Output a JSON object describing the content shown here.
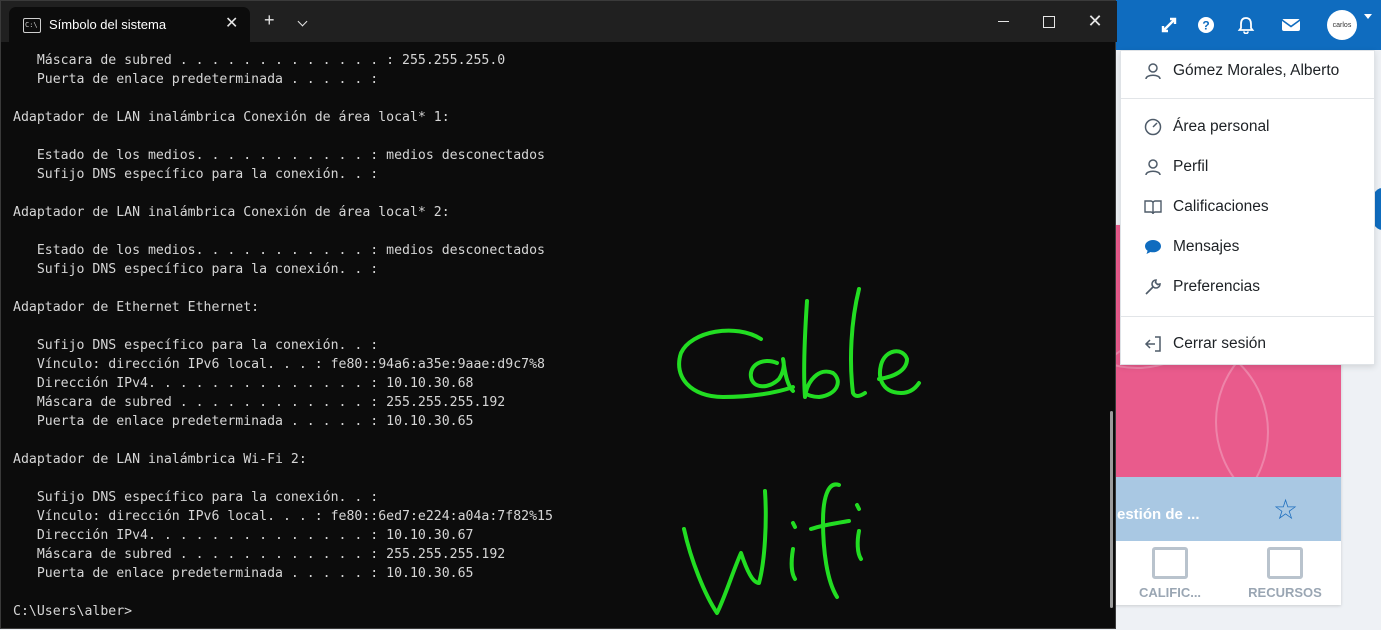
{
  "terminal": {
    "tab_title": "Símbolo del sistema",
    "lines": [
      "   Máscara de subred . . . . . . . . . . . . . : 255.255.255.0",
      "   Puerta de enlace predeterminada . . . . . : ",
      "",
      "Adaptador de LAN inalámbrica Conexión de área local* 1:",
      "",
      "   Estado de los medios. . . . . . . . . . . : medios desconectados",
      "   Sufijo DNS específico para la conexión. . : ",
      "",
      "Adaptador de LAN inalámbrica Conexión de área local* 2:",
      "",
      "   Estado de los medios. . . . . . . . . . . : medios desconectados",
      "   Sufijo DNS específico para la conexión. . : ",
      "",
      "Adaptador de Ethernet Ethernet:",
      "",
      "   Sufijo DNS específico para la conexión. . : ",
      "   Vínculo: dirección IPv6 local. . . : fe80::94a6:a35e:9aae:d9c7%8",
      "   Dirección IPv4. . . . . . . . . . . . . . : 10.10.30.68",
      "   Máscara de subred . . . . . . . . . . . . : 255.255.255.192",
      "   Puerta de enlace predeterminada . . . . . : 10.10.30.65",
      "",
      "Adaptador de LAN inalámbrica Wi-Fi 2:",
      "",
      "   Sufijo DNS específico para la conexión. . : ",
      "   Vínculo: dirección IPv6 local. . . : fe80::6ed7:e224:a04a:7f82%15",
      "   Dirección IPv4. . . . . . . . . . . . . . : 10.10.30.67",
      "   Máscara de subred . . . . . . . . . . . . : 255.255.255.192",
      "   Puerta de enlace predeterminada . . . . . : 10.10.30.65",
      "",
      "C:\\Users\\alber>"
    ]
  },
  "annotations": {
    "cable": "Cable",
    "wifi": "Wifi",
    "color": "#22dd22"
  },
  "lms": {
    "avatar_text": "carlos",
    "course_title": "estión de ...",
    "tabs": [
      "CALIFIC...",
      "RECURSOS"
    ],
    "user_menu": {
      "user_name": "Gómez Morales, Alberto",
      "items": [
        "Área personal",
        "Perfil",
        "Calificaciones",
        "Mensajes",
        "Preferencias"
      ],
      "logout": "Cerrar sesión"
    },
    "brand_color": "#0f6cbf"
  }
}
